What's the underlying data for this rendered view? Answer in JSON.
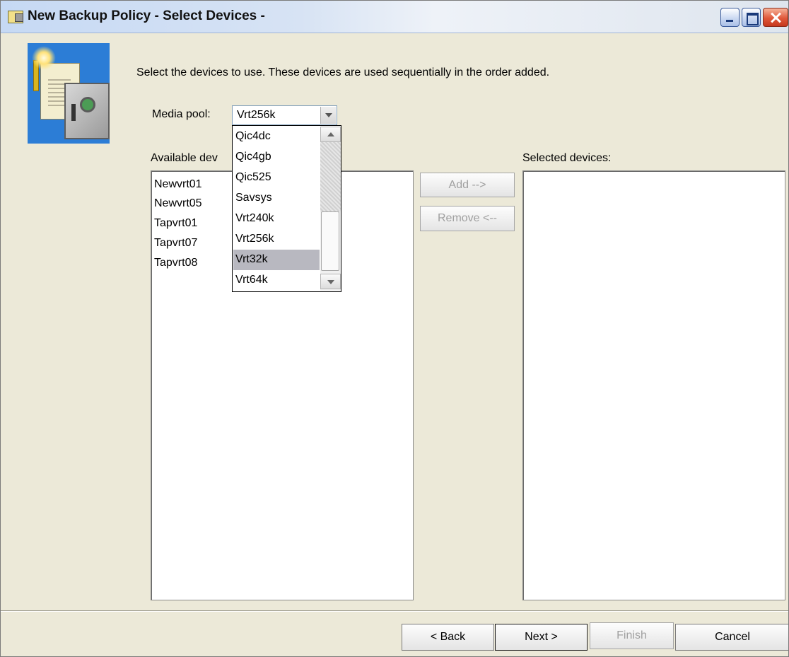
{
  "window": {
    "title": "New Backup Policy - Select Devices -"
  },
  "wizard": {
    "instruction": "Select the devices to use. These devices are used sequentially in the order added."
  },
  "media_pool": {
    "label": "Media pool:",
    "selected": "Vrt256k",
    "dropdown_options": [
      "Qic4dc",
      "Qic4gb",
      "Qic525",
      "Savsys",
      "Vrt240k",
      "Vrt256k",
      "Vrt32k",
      "Vrt64k"
    ],
    "highlighted_option": "Vrt32k"
  },
  "available": {
    "label": "Available dev",
    "items": [
      "Newvrt01",
      "Newvrt05",
      "Tapvrt01",
      "Tapvrt07",
      "Tapvrt08"
    ]
  },
  "selected": {
    "label": "Selected devices:",
    "items": []
  },
  "actions": {
    "add_label": "Add -->",
    "remove_label": "Remove <--"
  },
  "footer": {
    "back_label": "< Back",
    "next_label": "Next >",
    "finish_label": "Finish",
    "cancel_label": "Cancel"
  },
  "icons": {
    "window_icon": "backup-policy-icon",
    "wizard_image": "safe-document-key-image",
    "minimize": "minimize-icon",
    "maximize": "maximize-icon",
    "close": "close-icon"
  }
}
